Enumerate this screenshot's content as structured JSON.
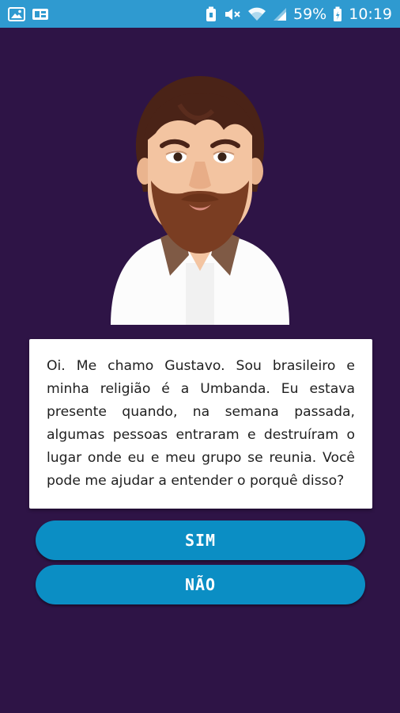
{
  "status_bar": {
    "battery_percent": "59%",
    "time": "10:19",
    "left_icons": [
      "image-icon",
      "gallery-icon"
    ],
    "right_icons": [
      "battery-saver-icon",
      "mute-icon",
      "wifi-icon",
      "signal-icon",
      "battery-icon"
    ]
  },
  "character": {
    "avatar_icon": "bearded-man-avatar"
  },
  "dialog": {
    "text": "Oi. Me chamo Gustavo. Sou brasileiro e minha religião é a Umbanda. Eu estava presente quando, na semana passada, algumas pessoas entraram e destruíram o lugar onde eu e meu grupo se reunia. Você pode me ajudar a entender o porquê disso?"
  },
  "buttons": {
    "yes_label": "SIM",
    "no_label": "NÃO"
  },
  "colors": {
    "background": "#2e1446",
    "status_bar": "#2f9ad0",
    "button": "#0b8ec4",
    "dialog_bg": "#ffffff"
  }
}
